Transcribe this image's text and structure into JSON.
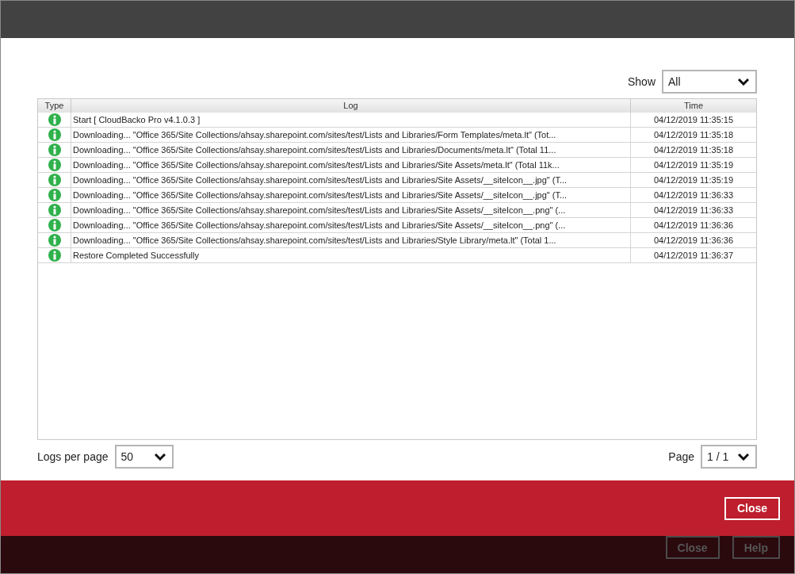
{
  "filter": {
    "label": "Show",
    "value": "All"
  },
  "table": {
    "columns": [
      "Type",
      "Log",
      "Time"
    ],
    "rows": [
      {
        "kind": "info",
        "log": "Start [ CloudBacko Pro v4.1.0.3 ]",
        "time": "04/12/2019 11:35:15"
      },
      {
        "kind": "info",
        "log": "Downloading... \"Office 365/Site Collections/ahsay.sharepoint.com/sites/test/Lists and Libraries/Form Templates/meta.lt\" (Tot...",
        "time": "04/12/2019 11:35:18"
      },
      {
        "kind": "info",
        "log": "Downloading... \"Office 365/Site Collections/ahsay.sharepoint.com/sites/test/Lists and Libraries/Documents/meta.lt\" (Total 11...",
        "time": "04/12/2019 11:35:18"
      },
      {
        "kind": "info",
        "log": "Downloading... \"Office 365/Site Collections/ahsay.sharepoint.com/sites/test/Lists and Libraries/Site Assets/meta.lt\" (Total 11k...",
        "time": "04/12/2019 11:35:19"
      },
      {
        "kind": "info",
        "log": "Downloading... \"Office 365/Site Collections/ahsay.sharepoint.com/sites/test/Lists and Libraries/Site Assets/__siteIcon__.jpg\" (T...",
        "time": "04/12/2019 11:35:19"
      },
      {
        "kind": "info",
        "log": "Downloading... \"Office 365/Site Collections/ahsay.sharepoint.com/sites/test/Lists and Libraries/Site Assets/__siteIcon__.jpg\" (T...",
        "time": "04/12/2019 11:36:33"
      },
      {
        "kind": "info",
        "log": "Downloading... \"Office 365/Site Collections/ahsay.sharepoint.com/sites/test/Lists and Libraries/Site Assets/__siteIcon__.png\" (...",
        "time": "04/12/2019 11:36:33"
      },
      {
        "kind": "info",
        "log": "Downloading... \"Office 365/Site Collections/ahsay.sharepoint.com/sites/test/Lists and Libraries/Site Assets/__siteIcon__.png\" (...",
        "time": "04/12/2019 11:36:36"
      },
      {
        "kind": "info",
        "log": "Downloading... \"Office 365/Site Collections/ahsay.sharepoint.com/sites/test/Lists and Libraries/Style Library/meta.lt\" (Total 1...",
        "time": "04/12/2019 11:36:36"
      },
      {
        "kind": "info",
        "log": "Restore Completed Successfully",
        "time": "04/12/2019 11:36:37"
      }
    ]
  },
  "logs_per_page": {
    "label": "Logs per page",
    "value": "50"
  },
  "page": {
    "label": "Page",
    "value": "1 / 1"
  },
  "dialog_button": "Close",
  "footer_buttons": [
    {
      "label": "Close",
      "disabled": true
    },
    {
      "label": "Help",
      "disabled": true
    }
  ]
}
